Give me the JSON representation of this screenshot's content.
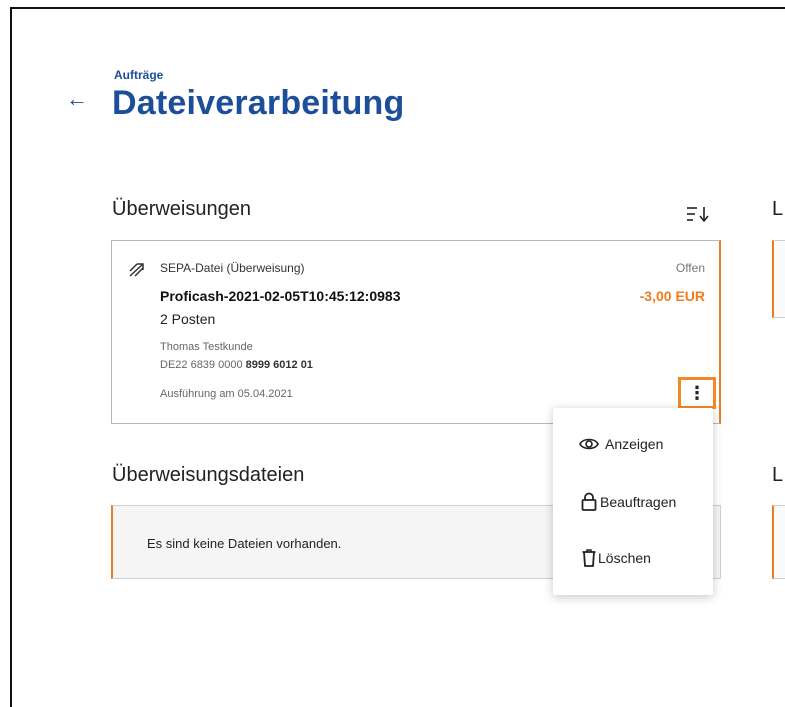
{
  "header": {
    "breadcrumb": "Aufträge",
    "title": "Dateiverarbeitung",
    "back_icon": "arrow-left-icon"
  },
  "sections": {
    "transfers_title": "Überweisungen",
    "files_title": "Überweisungsdateien",
    "right_column_letter_1": "L",
    "right_column_letter_2": "L"
  },
  "order_card": {
    "file_type": "SEPA-Datei (Überweisung)",
    "status": "Offen",
    "file_name": "Proficash-2021-02-05T10:45:12:0983",
    "amount": "-3,00 EUR",
    "items": "2 Posten",
    "owner": "Thomas Testkunde",
    "iban_prefix": "DE22 6839 0000 ",
    "iban_bold": "8999 6012 01",
    "execution": "Ausführung am 05.04.2021",
    "more_icon": "more-vertical-icon"
  },
  "files_empty": {
    "text": "Es sind keine Dateien vorhanden."
  },
  "context_menu": {
    "items": [
      {
        "label": "Anzeigen",
        "icon": "eye-icon"
      },
      {
        "label": "Beauftragen",
        "icon": "lock-icon"
      },
      {
        "label": "Löschen",
        "icon": "trash-icon"
      }
    ]
  },
  "colors": {
    "brand_blue": "#1c4e9a",
    "accent_orange": "#f07c1f",
    "highlight_orange": "#f5882a"
  }
}
